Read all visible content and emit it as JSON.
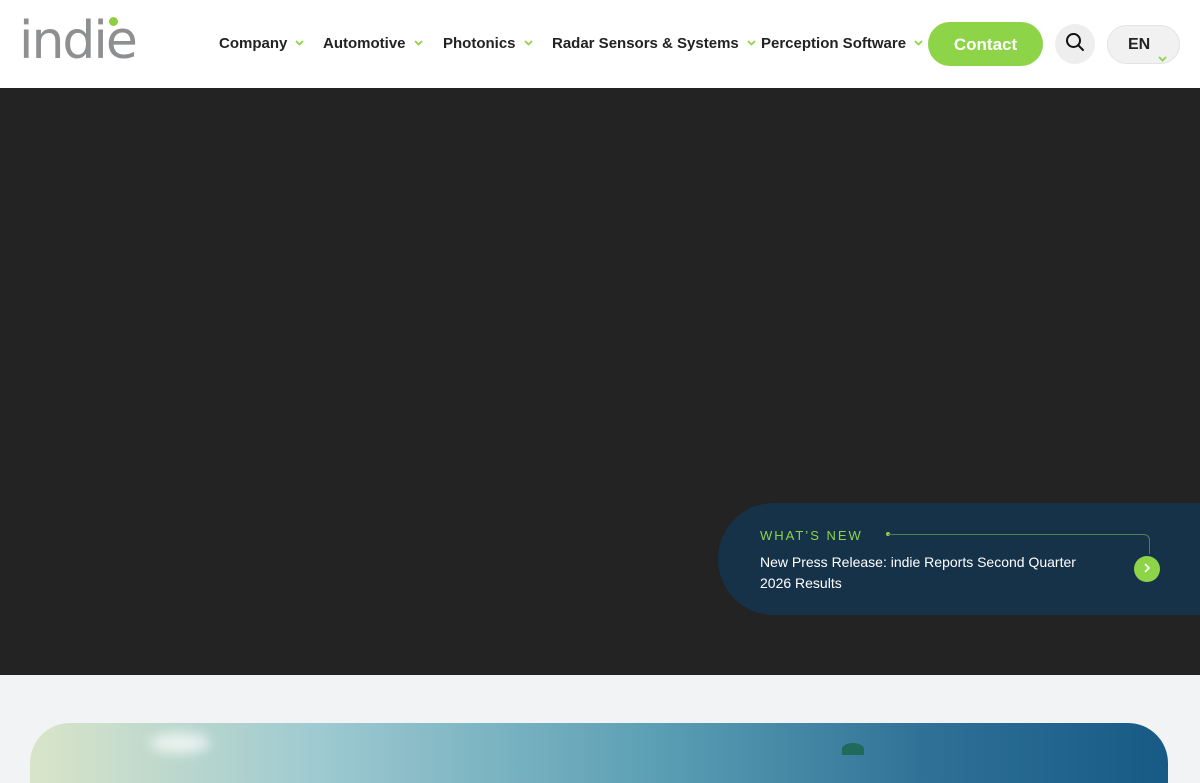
{
  "header": {
    "logo_text": "indie",
    "nav": [
      {
        "label": "Company"
      },
      {
        "label": "Automotive"
      },
      {
        "label": "Photonics"
      },
      {
        "label": "Radar Sensors & Systems"
      },
      {
        "label": "Perception Software"
      }
    ],
    "contact_label": "Contact",
    "search_icon": "search-icon",
    "language": "EN"
  },
  "news": {
    "label": "WHAT’S NEW",
    "text": "New Press Release: indie Reports Second Quarter 2026 Results",
    "arrow_icon": "chevron-right-icon"
  },
  "colors": {
    "accent": "#8dd449",
    "hero_bg": "#232323",
    "news_bg": "#163249",
    "text_dark": "#232323",
    "logo_gray": "#8e8f91"
  }
}
